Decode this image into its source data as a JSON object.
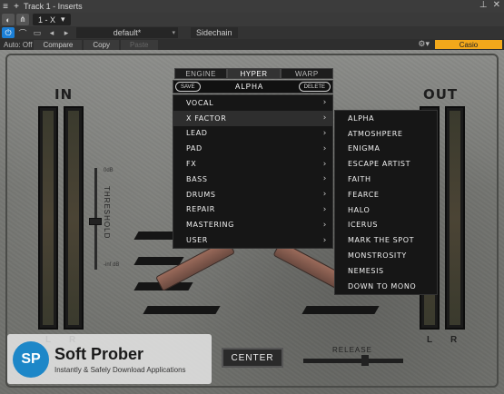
{
  "window": {
    "title": "Track 1 - Inserts",
    "track_select": "1 - X"
  },
  "toolbar": {
    "preset": "default*",
    "sidechain": "Sidechain",
    "auto": "Auto: Off",
    "compare": "Compare",
    "copy": "Copy",
    "paste": "Paste",
    "device": "Casio"
  },
  "plugin": {
    "in_label": "IN",
    "out_label": "OUT",
    "left": "L",
    "right": "R",
    "threshold_label": "THRESHOLD",
    "threshold_top": "0dB",
    "threshold_bottom": "-inf dB",
    "tabs": [
      "ENGINE",
      "HYPER",
      "WARP"
    ],
    "save": "SAVE",
    "current_preset": "ALPHA",
    "delete": "DELETE",
    "center_button": "CENTER",
    "release_label": "RELEASE"
  },
  "categories": [
    {
      "label": "VOCAL"
    },
    {
      "label": "X FACTOR",
      "highlighted": true
    },
    {
      "label": "LEAD"
    },
    {
      "label": "PAD"
    },
    {
      "label": "FX"
    },
    {
      "label": "BASS"
    },
    {
      "label": "DRUMS"
    },
    {
      "label": "REPAIR"
    },
    {
      "label": "MASTERING"
    },
    {
      "label": "USER"
    }
  ],
  "submenu": [
    "ALPHA",
    "ATMOSHPERE",
    "ENIGMA",
    "ESCAPE ARTIST",
    "FAITH",
    "FEARCE",
    "HALO",
    "ICERUS",
    "MARK THE SPOT",
    "MONSTROSITY",
    "NEMESIS",
    "DOWN TO MONO"
  ],
  "watermark": {
    "logo": "SP",
    "title": "Soft Prober",
    "subtitle": "Instantly & Safely Download Applications"
  }
}
